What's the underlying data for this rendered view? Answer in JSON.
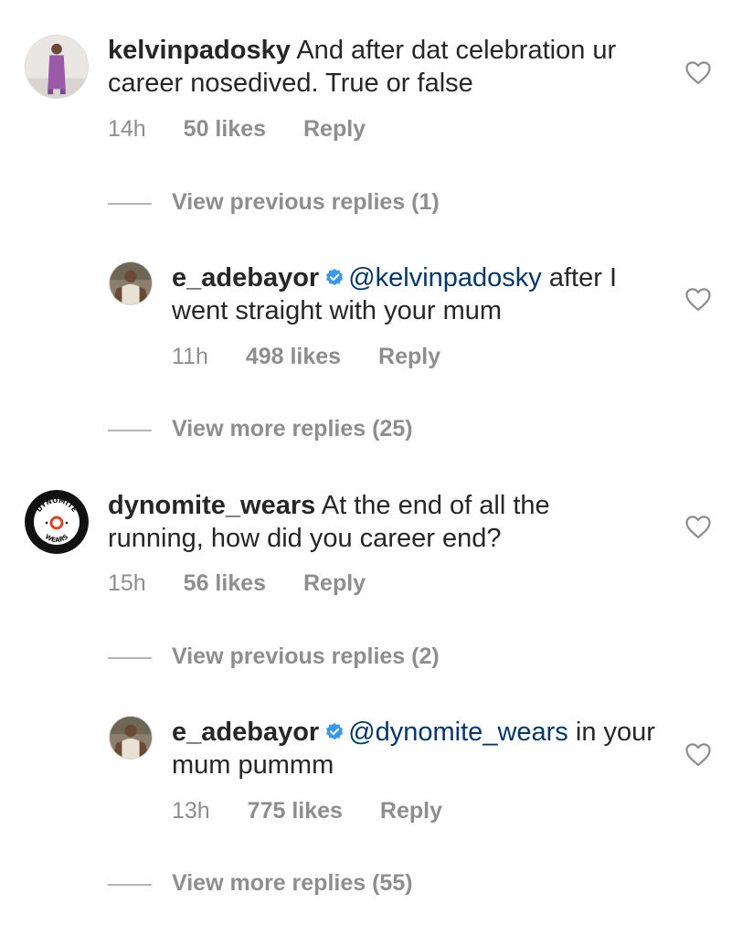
{
  "comments": [
    {
      "username": "kelvinpadosky",
      "text": "And after dat celebration ur career nosedived.  True or false",
      "time": "14h",
      "likes": "50 likes",
      "reply": "Reply",
      "view_replies": "View previous replies (1)"
    },
    {
      "username": "e_adebayor",
      "mention": "@kelvinpadosky",
      "text": " after I went straight with your mum",
      "time": "11h",
      "likes": "498 likes",
      "reply": "Reply",
      "view_replies": "View more replies (25)"
    },
    {
      "username": "dynomite_wears",
      "text": "At the end of all the running, how did you career end?",
      "time": "15h",
      "likes": "56 likes",
      "reply": "Reply",
      "view_replies": "View previous replies (2)",
      "avatar_text_top": "DYNOMITE",
      "avatar_text_bottom": "WEARS"
    },
    {
      "username": "e_adebayor",
      "mention": "@dynomite_wears",
      "text": " in your mum pummm",
      "time": "13h",
      "likes": "775 likes",
      "reply": "Reply",
      "view_replies": "View more replies (55)"
    }
  ],
  "colors": {
    "text": "#262626",
    "muted": "#8e8e8e",
    "mention": "#00376b",
    "verified": "#3897f0"
  },
  "icons": {
    "like": "heart-outline-icon",
    "verified": "verified-badge-icon"
  }
}
